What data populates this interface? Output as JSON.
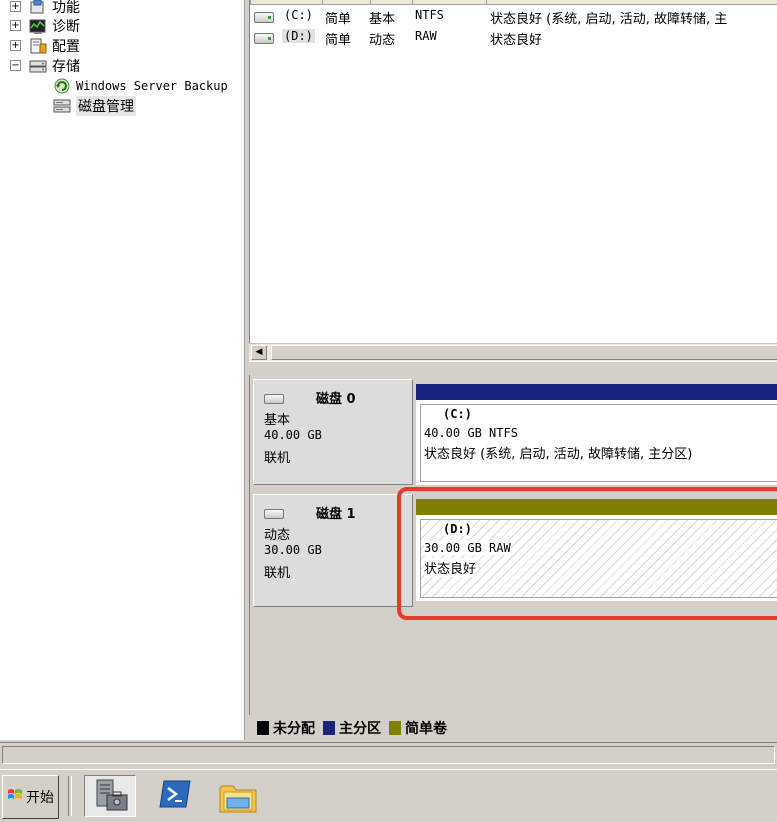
{
  "tree": {
    "items": [
      {
        "label": "功能",
        "expander": "+",
        "icon": "features-icon"
      },
      {
        "label": "诊断",
        "expander": "+",
        "icon": "diagnostics-icon"
      },
      {
        "label": "配置",
        "expander": "+",
        "icon": "configuration-icon"
      },
      {
        "label": "存储",
        "expander": "−",
        "icon": "storage-icon"
      },
      {
        "label": "Windows Server Backup",
        "icon": "backup-icon"
      },
      {
        "label": "磁盘管理",
        "icon": "disk-management-icon",
        "selected": true
      }
    ]
  },
  "volume_list": {
    "rows": [
      {
        "volume": "(C:)",
        "layout": "简单",
        "type": "基本",
        "fs": "NTFS",
        "status": "状态良好 (系统, 启动, 活动, 故障转储, 主"
      },
      {
        "volume": "(D:)",
        "layout": "简单",
        "type": "动态",
        "fs": "RAW",
        "status": "状态良好"
      }
    ]
  },
  "disks": [
    {
      "name": "磁盘 0",
      "type": "基本",
      "size": "40.00 GB",
      "state": "联机",
      "partition": {
        "label": "(C:)",
        "size_fs": "40.00 GB NTFS",
        "status": "状态良好 (系统, 启动, 活动, 故障转储, 主分区)",
        "bar_color": "#1a237e"
      }
    },
    {
      "name": "磁盘 1",
      "type": "动态",
      "size": "30.00 GB",
      "state": "联机",
      "partition": {
        "label": "(D:)",
        "size_fs": "30.00 GB RAW",
        "status": "状态良好",
        "bar_color": "#808000"
      }
    }
  ],
  "legend": [
    {
      "label": "未分配",
      "color": "#000000"
    },
    {
      "label": "主分区",
      "color": "#1a237e"
    },
    {
      "label": "简单卷",
      "color": "#808000"
    }
  ],
  "taskbar": {
    "start_label": "开始",
    "buttons": [
      {
        "name": "server-manager-icon",
        "active": true
      },
      {
        "name": "powershell-icon",
        "active": false
      },
      {
        "name": "explorer-icon",
        "active": false
      }
    ]
  },
  "highlight_color": "#e8392e"
}
